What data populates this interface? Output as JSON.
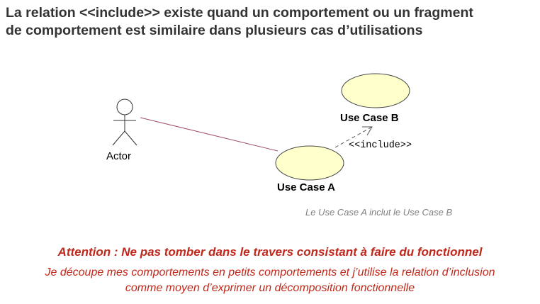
{
  "title": {
    "line1": "La relation <<include>> existe quand un comportement ou un fragment",
    "line2": "de comportement est similaire dans plusieurs cas d’utilisations"
  },
  "diagram": {
    "actor_label": "Actor",
    "use_case_a_label": "Use Case A",
    "use_case_b_label": "Use Case B",
    "include_label": "<<include>>",
    "caption": "Le Use Case A inclut le Use Case B"
  },
  "warning": {
    "title": "Attention : Ne pas tomber dans le travers consistant à faire du fonctionnel",
    "line1": "Je découpe mes comportements en petits comportements et j’utilise la relation d’inclusion",
    "line2": "comme moyen d’exprimer un décomposition fonctionnelle"
  },
  "colors": {
    "use_case_fill": "#ffffcc",
    "association_line": "#a0506e",
    "warning_text": "#c0281b",
    "caption_text": "#808080"
  }
}
